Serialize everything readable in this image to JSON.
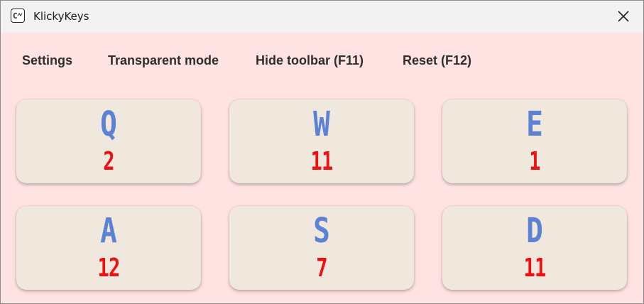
{
  "window": {
    "title": "KlickyKeys"
  },
  "toolbar": {
    "settings_label": "Settings",
    "transparent_label": "Transparent mode",
    "hide_toolbar_label": "Hide toolbar (F11)",
    "reset_label": "Reset (F12)"
  },
  "keys": [
    {
      "letter": "Q",
      "count": "2"
    },
    {
      "letter": "W",
      "count": "11"
    },
    {
      "letter": "E",
      "count": "1"
    },
    {
      "letter": "A",
      "count": "12"
    },
    {
      "letter": "S",
      "count": "7"
    },
    {
      "letter": "D",
      "count": "11"
    }
  ],
  "colors": {
    "background": "#ffe3e3",
    "key_face": "#f0e8dd",
    "letter": "#5b82d4",
    "count": "#ee1111",
    "titlebar": "#f2f2f2"
  },
  "icons": {
    "app": "klickykeys-app-icon",
    "close": "close-icon"
  }
}
